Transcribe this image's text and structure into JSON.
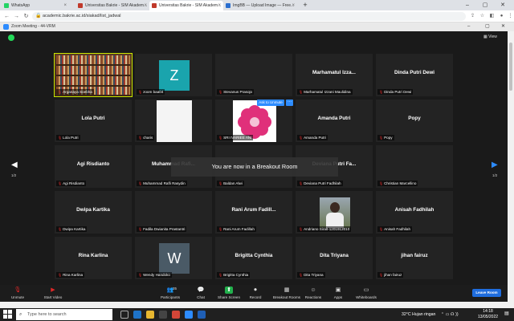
{
  "browser": {
    "tabs": [
      {
        "label": "WhatsApp",
        "color": "#25d366"
      },
      {
        "label": "Universitas Bakrie - SIM Akadem...",
        "color": "#c0392b"
      },
      {
        "label": "Universitas Bakrie - SIM Akadem...",
        "color": "#c0392b"
      },
      {
        "label": "ImgBB — Upload Image — Free...",
        "color": "#2a6ecf"
      }
    ],
    "new_tab": "+",
    "url": "academic.bakrie.ac.id/siakad/list_jadwal"
  },
  "zoom": {
    "window_title": "Zoom Meeting - 44-VRM",
    "view_label": "View",
    "page_left": "1/2",
    "page_right": "1/2",
    "breakout_message": "You are now in a Breakout Room",
    "ask_unmute": "Ask to Unmute",
    "ask_more": "···",
    "participants_count": "35",
    "leave_label": "Leave Room",
    "toolbar": [
      {
        "label": "Unmute",
        "icon": "mic-muted-icon"
      },
      {
        "label": "Start Video",
        "icon": "video-off-icon"
      },
      {
        "label": "Participants",
        "icon": "participants-icon"
      },
      {
        "label": "Chat",
        "icon": "chat-icon"
      },
      {
        "label": "Share Screen",
        "icon": "share-screen-icon"
      },
      {
        "label": "Record",
        "icon": "record-icon"
      },
      {
        "label": "Breakout Rooms",
        "icon": "breakout-rooms-icon"
      },
      {
        "label": "Reactions",
        "icon": "reactions-icon"
      },
      {
        "label": "Apps",
        "icon": "apps-icon"
      },
      {
        "label": "Whiteboards",
        "icon": "whiteboards-icon"
      }
    ],
    "tiles": [
      {
        "name": "",
        "label": "Arganaya Soebha",
        "kind": "bookshelf"
      },
      {
        "name": "",
        "label": "zoom baa04",
        "kind": "letter",
        "letter": "Z",
        "color": "#1e9fa8"
      },
      {
        "name": "",
        "label": "Stevanus Prasojo",
        "kind": "dark"
      },
      {
        "name": "Marhamatul Izza...",
        "label": "Marhamatul Izzani Maulidina",
        "kind": "name"
      },
      {
        "name": "Dinda Putri Dewi",
        "label": "Dinda Putri Dewi",
        "kind": "name"
      },
      {
        "name": "Lola Putri",
        "label": "Lola Putri",
        "kind": "name"
      },
      {
        "name": "",
        "label": "charis",
        "kind": "white"
      },
      {
        "name": "",
        "label": "SRI IVARIEE ANI",
        "kind": "flower"
      },
      {
        "name": "Amanda Putri",
        "label": "Amanda Putri",
        "kind": "name"
      },
      {
        "name": "Popy",
        "label": "Popy",
        "kind": "name"
      },
      {
        "name": "Agi Risdianto",
        "label": "Agi Risdianto",
        "kind": "name"
      },
      {
        "name": "Muhammad Rafi...",
        "label": "Muhammad Rafli Rasydin",
        "kind": "name"
      },
      {
        "name": "",
        "label": "Baldan Alwi",
        "kind": "dark"
      },
      {
        "name": "Deviana Putri Fa...",
        "label": "Deviana Putri Fadhilah",
        "kind": "name"
      },
      {
        "name": "",
        "label": "Christian Marcellino",
        "kind": "dark"
      },
      {
        "name": "Dwipa Kartika",
        "label": "Dwipa Kartika",
        "kind": "name"
      },
      {
        "name": "",
        "label": "Fadila Dwianita Prastantri",
        "kind": "dark"
      },
      {
        "name": "Rani Arum Fadill...",
        "label": "Rani Arum Fadillah",
        "kind": "name"
      },
      {
        "name": "",
        "label": "Andriano Siralt-1201912010",
        "kind": "photo"
      },
      {
        "name": "Anisah Fadhilah",
        "label": "Anisah Fadhilah",
        "kind": "name"
      },
      {
        "name": "Rina Karlina",
        "label": "Rina Karlina",
        "kind": "name"
      },
      {
        "name": "",
        "label": "Wendy Handoko",
        "kind": "letter",
        "letter": "W",
        "color": "#4a5a66"
      },
      {
        "name": "Brigitta Cynthia",
        "label": "Brigitta Cynthia",
        "kind": "name"
      },
      {
        "name": "Dita Triyana",
        "label": "Dita Triyana",
        "kind": "name"
      },
      {
        "name": "jihan fairuz",
        "label": "jihan fairuz",
        "kind": "name"
      }
    ]
  },
  "taskbar": {
    "search_placeholder": "Type here to search",
    "weather": "32°C  Hujan ringan",
    "time": "14:18",
    "date": "13/05/2022"
  }
}
